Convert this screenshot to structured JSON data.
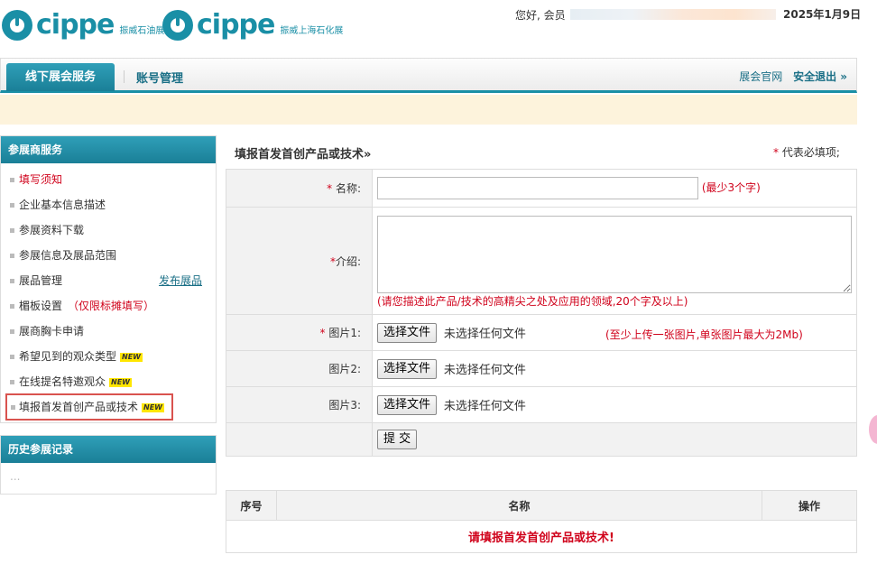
{
  "header": {
    "logo1": {
      "word": "cippe",
      "sub": "振威石油展"
    },
    "logo2": {
      "word": "cippe",
      "sub": "振威上海石化展"
    },
    "greeting": "您好, 会员",
    "date": "2025年1月9日"
  },
  "nav": {
    "tab_active": "线下展会服务",
    "tab_account": "账号管理",
    "official_site": "展会官网",
    "logout": "安全退出 »"
  },
  "sidebar": {
    "title": "参展商服务",
    "items": [
      {
        "label": "填写须知"
      },
      {
        "label": "企业基本信息描述"
      },
      {
        "label": "参展资料下载"
      },
      {
        "label": "参展信息及展品范围"
      },
      {
        "label": "展品管理",
        "link": "发布展品"
      },
      {
        "label": "楣板设置",
        "hint": "（仅限标摊填写）"
      },
      {
        "label": "展商胸卡申请"
      },
      {
        "label": "希望见到的观众类型",
        "badge": "NEW"
      },
      {
        "label": "在线提名特邀观众",
        "badge": "NEW"
      },
      {
        "label": "填报首发首创产品或技术",
        "badge": "NEW"
      }
    ],
    "history_title": "历史参展记录",
    "history_empty": "..."
  },
  "main": {
    "title": "填报首发首创产品或技术»",
    "required_note": "代表必填项;",
    "required_star": "*",
    "form": {
      "name_label": "名称:",
      "name_hint": "(最少3个字)",
      "intro_label": "介绍:",
      "intro_hint": "(请您描述此产品/技术的高精尖之处及应用的领域,20个字及以上)",
      "image1_label": "图片1:",
      "image2_label": "图片2:",
      "image3_label": "图片3:",
      "file_button": "选择文件",
      "file_status": "未选择任何文件",
      "image_hint": "(至少上传一张图片,单张图片最大为2Mb)",
      "submit": "提 交"
    },
    "list": {
      "col_index": "序号",
      "col_name": "名称",
      "col_action": "操作",
      "empty_message": "请填报首发首创产品或技术!"
    }
  },
  "colors": {
    "accent": "#1a8fa6",
    "required": "#d0021b",
    "notice_bg": "#fdf3dc"
  }
}
